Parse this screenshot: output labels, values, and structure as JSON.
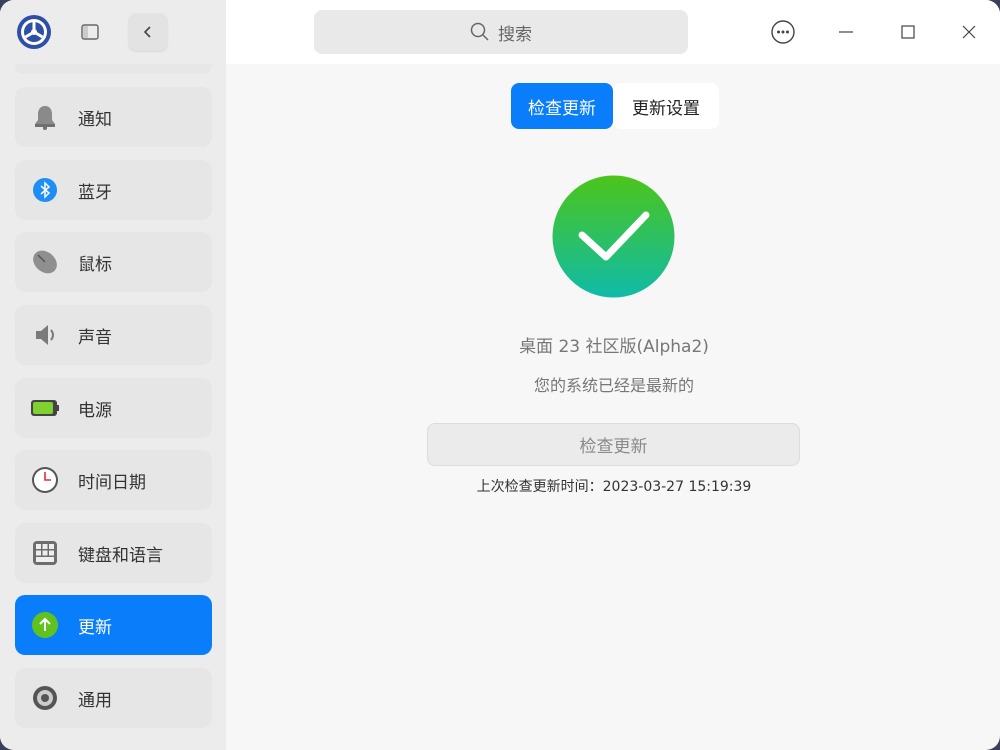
{
  "search": {
    "placeholder": "搜索"
  },
  "sidebar": {
    "items": [
      {
        "label": "通知",
        "icon": "bell-icon"
      },
      {
        "label": "蓝牙",
        "icon": "bluetooth-icon"
      },
      {
        "label": "鼠标",
        "icon": "mouse-icon"
      },
      {
        "label": "声音",
        "icon": "speaker-icon"
      },
      {
        "label": "电源",
        "icon": "battery-icon"
      },
      {
        "label": "时间日期",
        "icon": "clock-icon"
      },
      {
        "label": "键盘和语言",
        "icon": "keyboard-icon"
      },
      {
        "label": "更新",
        "icon": "update-arrow-icon",
        "active": true
      },
      {
        "label": "通用",
        "icon": "gear-icon"
      }
    ]
  },
  "tabs": [
    {
      "label": "检查更新",
      "active": true
    },
    {
      "label": "更新设置",
      "active": false
    }
  ],
  "main": {
    "version": "桌面 23 社区版(Alpha2)",
    "status": "您的系统已经是最新的",
    "check_button": "检查更新",
    "last_check": "上次检查更新时间：2023-03-27 15:19:39"
  },
  "colors": {
    "accent": "#0a7dfa",
    "success_start": "#4cc51a",
    "success_end": "#0fbba8"
  }
}
